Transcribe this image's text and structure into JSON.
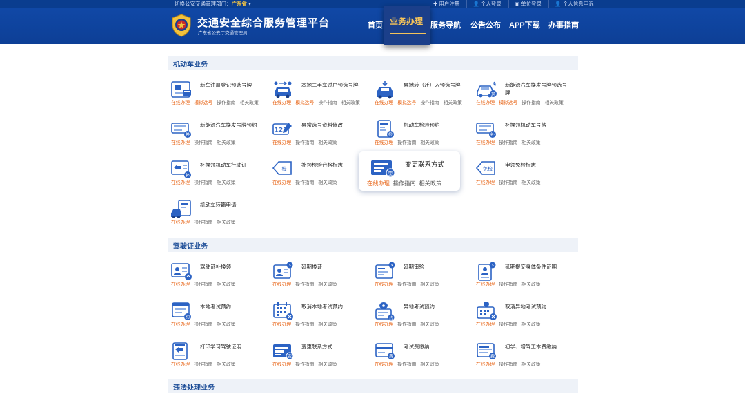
{
  "topbar": {
    "dept_label": "切换公安交通管理部门：",
    "province": "广东省",
    "caret": "▾",
    "links": [
      "用户注册",
      "个人登录",
      "单位登录",
      "个人信息申诉"
    ]
  },
  "header": {
    "title": "交通安全综合服务管理平台",
    "subtitle": "广东省公安厅交通管理局",
    "nav": [
      "首页",
      "业务办理",
      "服务导航",
      "公告公布",
      "APP下载",
      "办事指南"
    ],
    "active_nav_index": 1
  },
  "sections": [
    {
      "title": "机动车业务",
      "items": [
        {
          "name": "新车注册登记预选号牌",
          "links": [
            "在线办理",
            "模拟选号",
            "操作指南",
            "相关政策"
          ],
          "icon": "car-card-icon"
        },
        {
          "name": "本地二手车过户预选号牌",
          "links": [
            "在线办理",
            "模拟选号",
            "操作指南",
            "相关政策"
          ],
          "icon": "car-transfer-icon"
        },
        {
          "name": "异地转（迁）入预选号牌",
          "links": [
            "在线办理",
            "模拟选号",
            "操作指南",
            "相关政策"
          ],
          "icon": "car-import-icon"
        },
        {
          "name": "新能源汽车换发号牌预选号牌",
          "links": [
            "在线办理",
            "模拟选号",
            "操作指南",
            "相关政策"
          ],
          "icon": "ev-car-icon"
        },
        {
          "name": "新能源汽车换发号牌预约",
          "links": [
            "在线办理",
            "操作指南",
            "相关政策"
          ],
          "icon": "plate-exchange-icon"
        },
        {
          "name": "异常选号资料修改",
          "links": [
            "在线办理",
            "操作指南",
            "相关政策"
          ],
          "icon": "number-edit-icon"
        },
        {
          "name": "机动车检验预约",
          "links": [
            "在线办理",
            "操作指南",
            "相关政策"
          ],
          "icon": "inspection-doc-icon"
        },
        {
          "name": "补换领机动车号牌",
          "links": [
            "在线办理",
            "操作指南",
            "相关政策"
          ],
          "icon": "plate-replace-icon"
        },
        {
          "name": "补换领机动车行驶证",
          "links": [
            "在线办理",
            "操作指南",
            "相关政策"
          ],
          "icon": "license-replace-icon"
        },
        {
          "name": "补领检验合格标志",
          "links": [
            "在线办理",
            "操作指南",
            "相关政策"
          ],
          "icon": "check-tag-icon"
        },
        {
          "name": "变更联系方式",
          "links": [
            "在线办理",
            "操作指南",
            "相关政策"
          ],
          "icon": "contact-change-icon"
        },
        {
          "name": "申领免检标志",
          "links": [
            "在线办理",
            "操作指南",
            "相关政策"
          ],
          "icon": "exempt-tag-icon"
        },
        {
          "name": "机动车转籍申请",
          "links": [
            "在线办理",
            "操作指南",
            "相关政策"
          ],
          "icon": "vehicle-transfer-icon"
        }
      ]
    },
    {
      "title": "驾驶证业务",
      "items": [
        {
          "name": "驾驶证补换领",
          "links": [
            "在线办理",
            "操作指南",
            "相关政策"
          ],
          "icon": "driver-license-icon"
        },
        {
          "name": "延期换证",
          "links": [
            "在线办理",
            "操作指南",
            "相关政策"
          ],
          "icon": "renew-delay-icon"
        },
        {
          "name": "延期审验",
          "links": [
            "在线办理",
            "操作指南",
            "相关政策"
          ],
          "icon": "review-delay-icon"
        },
        {
          "name": "延期提交身体条件证明",
          "links": [
            "在线办理",
            "操作指南",
            "相关政策"
          ],
          "icon": "health-cert-icon"
        },
        {
          "name": "本地考试预约",
          "links": [
            "在线办理",
            "操作指南",
            "相关政策"
          ],
          "icon": "exam-local-icon"
        },
        {
          "name": "取消本地考试预约",
          "links": [
            "在线办理",
            "操作指南",
            "相关政策"
          ],
          "icon": "exam-cancel-icon"
        },
        {
          "name": "异地考试预约",
          "links": [
            "在线办理",
            "操作指南",
            "相关政策"
          ],
          "icon": "exam-remote-icon"
        },
        {
          "name": "取消异地考试预约",
          "links": [
            "在线办理",
            "操作指南",
            "相关政策"
          ],
          "icon": "exam-remote-cancel-icon"
        },
        {
          "name": "打印学习驾驶证明",
          "links": [
            "在线办理",
            "操作指南",
            "相关政策"
          ],
          "icon": "print-cert-icon"
        },
        {
          "name": "变更联系方式",
          "links": [
            "在线办理",
            "操作指南",
            "相关政策"
          ],
          "icon": "contact-change-icon"
        },
        {
          "name": "考试费缴纳",
          "links": [
            "在线办理",
            "操作指南",
            "相关政策"
          ],
          "icon": "exam-fee-icon"
        },
        {
          "name": "初学、增驾工本费缴纳",
          "links": [
            "在线办理",
            "操作指南",
            "相关政策"
          ],
          "icon": "cost-fee-icon"
        }
      ]
    },
    {
      "title": "违法处理业务",
      "items": []
    }
  ],
  "colors": {
    "header_bg": "#0d3f96",
    "topbar_bg": "#0a3d8f",
    "accent_gold": "#f4c35a",
    "link_orange": "#e8671a",
    "section_bg": "#eef2f8",
    "section_title": "#1a4b96"
  }
}
